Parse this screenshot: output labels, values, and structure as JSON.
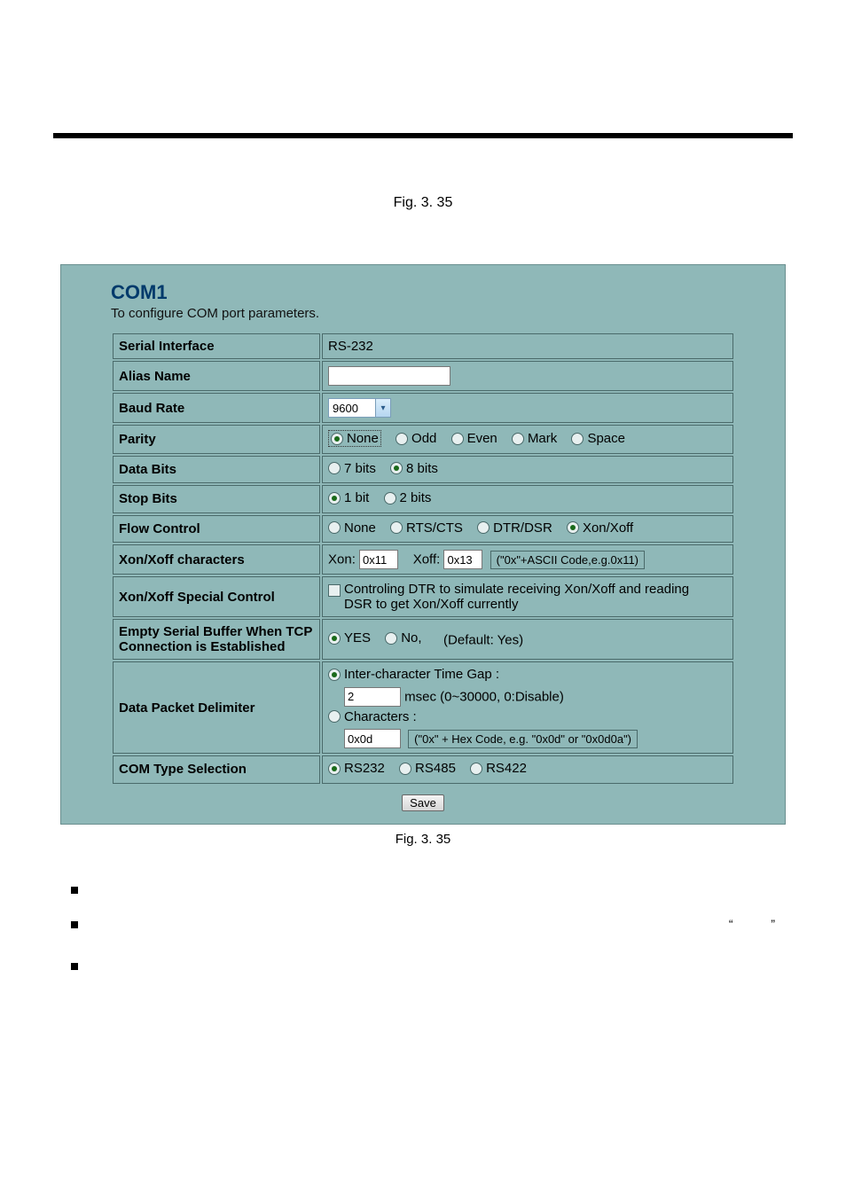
{
  "fig_top": "Fig. 3. 35",
  "panel": {
    "title": "COM1",
    "subtitle": "To configure COM port parameters.",
    "save_button": "Save"
  },
  "rows": {
    "serial_interface": {
      "label": "Serial Interface",
      "value": "RS-232"
    },
    "alias_name": {
      "label": "Alias Name",
      "value": ""
    },
    "baud_rate": {
      "label": "Baud Rate",
      "value": "9600"
    },
    "parity": {
      "label": "Parity",
      "options": [
        "None",
        "Odd",
        "Even",
        "Mark",
        "Space"
      ],
      "selected": "None"
    },
    "data_bits": {
      "label": "Data Bits",
      "options": [
        "7 bits",
        "8 bits"
      ],
      "selected": "8 bits"
    },
    "stop_bits": {
      "label": "Stop Bits",
      "options": [
        "1 bit",
        "2 bits"
      ],
      "selected": "1 bit"
    },
    "flow_control": {
      "label": "Flow Control",
      "options": [
        "None",
        "RTS/CTS",
        "DTR/DSR",
        "Xon/Xoff"
      ],
      "selected": "Xon/Xoff"
    },
    "xonxoff_chars": {
      "label": "Xon/Xoff characters",
      "xon_label": "Xon:",
      "xon_value": "0x11",
      "xoff_label": "Xoff:",
      "xoff_value": "0x13",
      "hint": "(\"0x\"+ASCII Code,e.g.0x11)"
    },
    "xonxoff_special": {
      "label": "Xon/Xoff Special Control",
      "checkbox_text": "Controling DTR to simulate receiving Xon/Xoff and reading DSR to get Xon/Xoff currently",
      "checked": false
    },
    "empty_buffer": {
      "label": "Empty Serial Buffer When TCP Connection is Established",
      "options": [
        "YES",
        "No,"
      ],
      "selected": "YES",
      "suffix": "(Default: Yes)"
    },
    "delimiter": {
      "label": "Data Packet Delimiter",
      "option_gap": "Inter-character Time Gap :",
      "gap_value": "2",
      "gap_suffix": "msec (0~30000, 0:Disable)",
      "option_chars": "Characters :",
      "chars_value": "0x0d",
      "chars_hint": "(\"0x\" + Hex Code, e.g. \"0x0d\" or \"0x0d0a\")",
      "selected": "gap"
    },
    "com_type": {
      "label": "COM Type Selection",
      "options": [
        "RS232",
        "RS485",
        "RS422"
      ],
      "selected": "RS232"
    }
  },
  "fig_bottom": "Fig. 3. 35",
  "quotes": "“           ”"
}
